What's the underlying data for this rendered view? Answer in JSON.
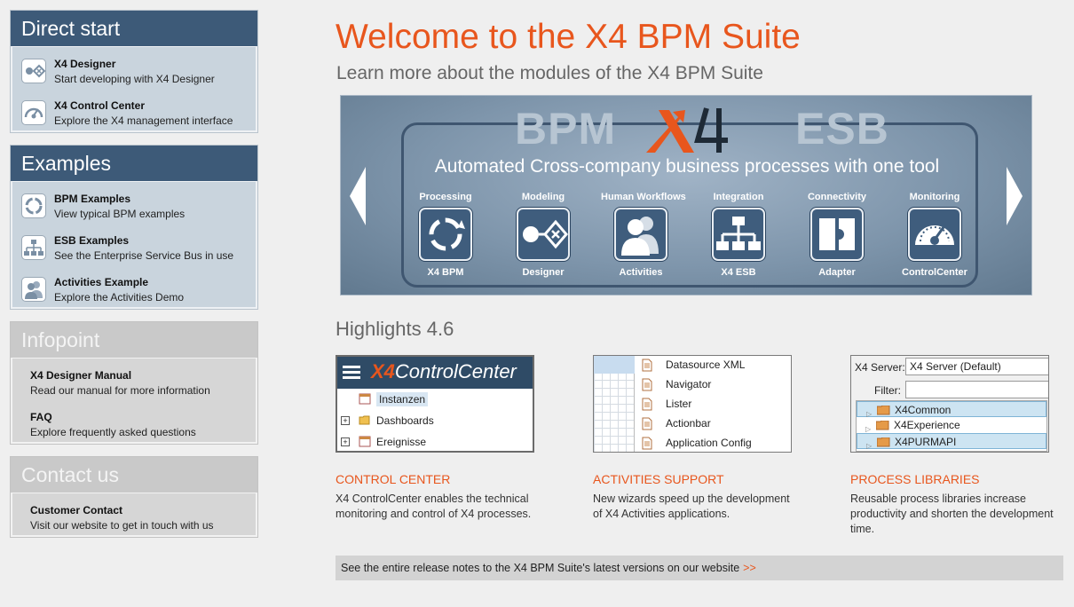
{
  "sidebar": {
    "direct_start": {
      "title": "Direct start",
      "items": [
        {
          "title": "X4 Designer",
          "sub": "Start developing with X4 Designer",
          "icon": "designer-icon"
        },
        {
          "title": "X4 Control Center",
          "sub": "Explore the X4 management interface",
          "icon": "gauge-icon"
        }
      ]
    },
    "examples": {
      "title": "Examples",
      "items": [
        {
          "title": "BPM Examples",
          "sub": "View typical BPM examples",
          "icon": "cycle-icon"
        },
        {
          "title": "ESB Examples",
          "sub": "See the Enterprise Service Bus in use",
          "icon": "network-icon"
        },
        {
          "title": "Activities Example",
          "sub": "Explore the Activities Demo",
          "icon": "users-icon"
        }
      ]
    },
    "infopoint": {
      "title": "Infopoint",
      "items": [
        {
          "title": "X4 Designer Manual",
          "sub": "Read our manual for more information"
        },
        {
          "title": "FAQ",
          "sub": "Explore frequently asked questions"
        }
      ]
    },
    "contact": {
      "title": "Contact us",
      "items": [
        {
          "title": "Customer Contact",
          "sub": "Visit our website to get in touch with us"
        }
      ]
    }
  },
  "main": {
    "title": "Welcome to the X4 BPM Suite",
    "subtitle": "Learn more about the modules of the X4 BPM Suite",
    "banner": {
      "bpm": "BPM",
      "esb": "ESB",
      "tagline": "Automated Cross-company business processes with one tool",
      "modules": [
        {
          "top": "Processing",
          "bottom": "X4 BPM",
          "icon": "cycle-icon"
        },
        {
          "top": "Modeling",
          "bottom": "Designer",
          "icon": "designer-icon"
        },
        {
          "top": "Human Workflows",
          "bottom": "Activities",
          "icon": "users-icon"
        },
        {
          "top": "Integration",
          "bottom": "X4 ESB",
          "icon": "network-icon"
        },
        {
          "top": "Connectivity",
          "bottom": "Adapter",
          "icon": "adapter-icon"
        },
        {
          "top": "Monitoring",
          "bottom": "ControlCenter",
          "icon": "gauge-icon"
        }
      ]
    },
    "highlights_title": "Highlights 4.6",
    "shots": {
      "control_center": {
        "logo_x4": "X4",
        "logo_text": "ControlCenter",
        "rows": [
          "Instanzen",
          "Dashboards",
          "Ereignisse"
        ]
      },
      "activities": {
        "rows": [
          "Datasource XML",
          "Navigator",
          "Lister",
          "Actionbar",
          "Application Config"
        ]
      },
      "libraries": {
        "server_label": "X4 Server:",
        "server_value": "X4 Server (Default)",
        "filter_label": "Filter:",
        "items": [
          "X4Common",
          "X4Experience",
          "X4PURMAPI"
        ]
      }
    },
    "highlights": [
      {
        "head": "CONTROL CENTER",
        "text": "X4 ControlCenter enables the technical monitoring and control of X4 processes."
      },
      {
        "head": "ACTIVITIES SUPPORT",
        "text": "New wizards speed up the development of X4 Activities applications."
      },
      {
        "head": "PROCESS LIBRARIES",
        "text": "Reusable process libraries increase productivity and shorten the development time."
      }
    ],
    "footer": {
      "text": "See the entire release notes to the X4 BPM Suite's latest versions on our website",
      "more": ">>"
    }
  },
  "colors": {
    "accent": "#e8561d",
    "navy": "#3d5a78",
    "panel_light": "#c9d4dd",
    "gray_panel": "#c9c9c9"
  }
}
